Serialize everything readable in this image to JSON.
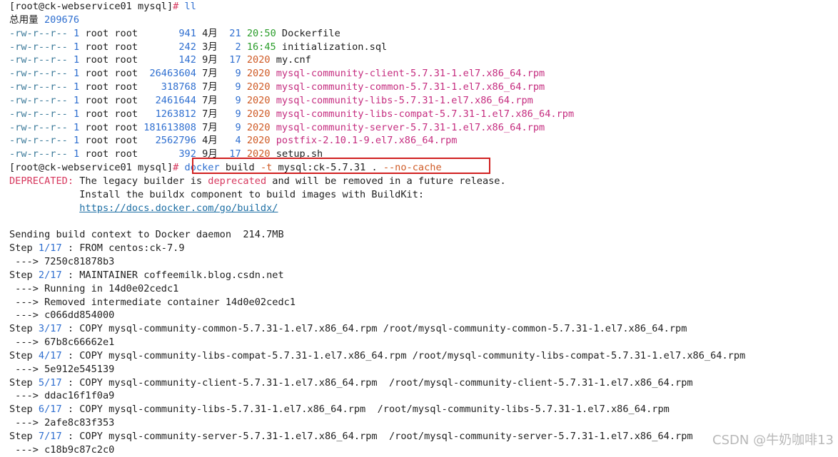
{
  "colors": {
    "background": "#ffffff",
    "perm": "#3c7a9a",
    "size": "#2f6fd0",
    "rpm": "#c52c7f",
    "deprecated": "#d7385e",
    "time": "#2a9d2a",
    "highlight_box": "#d02020"
  },
  "watermark": "CSDN @牛奶咖啡13",
  "lines": [
    {
      "name": "prompt-line-1",
      "segs": [
        [
          "[root@ck-webservice01 mysql]",
          ""
        ],
        [
          "# ",
          "c-red"
        ],
        [
          "ll",
          "c-blue"
        ]
      ]
    },
    {
      "name": "total-line",
      "segs": [
        [
          "总用量 ",
          ""
        ],
        [
          "209676",
          "c-blue"
        ]
      ]
    },
    {
      "name": "ls-row",
      "segs": [
        [
          "-rw-r--r-- ",
          "c-dim"
        ],
        [
          "1",
          "c-blue"
        ],
        [
          " root root       ",
          ""
        ],
        [
          "941",
          "c-blue"
        ],
        [
          " 4月  ",
          ""
        ],
        [
          "21",
          "c-blue"
        ],
        [
          " ",
          ""
        ],
        [
          "20:50",
          "c-green"
        ],
        [
          " Dockerfile",
          ""
        ]
      ]
    },
    {
      "name": "ls-row",
      "segs": [
        [
          "-rw-r--r-- ",
          "c-dim"
        ],
        [
          "1",
          "c-blue"
        ],
        [
          " root root       ",
          ""
        ],
        [
          "242",
          "c-blue"
        ],
        [
          " 3月   ",
          ""
        ],
        [
          "2",
          "c-blue"
        ],
        [
          " ",
          ""
        ],
        [
          "16:45",
          "c-green"
        ],
        [
          " initialization.sql",
          ""
        ]
      ]
    },
    {
      "name": "ls-row",
      "segs": [
        [
          "-rw-r--r-- ",
          "c-dim"
        ],
        [
          "1",
          "c-blue"
        ],
        [
          " root root       ",
          ""
        ],
        [
          "142",
          "c-blue"
        ],
        [
          " 9月  ",
          ""
        ],
        [
          "17",
          "c-blue"
        ],
        [
          " ",
          ""
        ],
        [
          "2020",
          "c-orange"
        ],
        [
          " my.cnf",
          ""
        ]
      ]
    },
    {
      "name": "ls-row",
      "segs": [
        [
          "-rw-r--r-- ",
          "c-dim"
        ],
        [
          "1",
          "c-blue"
        ],
        [
          " root root  ",
          ""
        ],
        [
          "26463604",
          "c-blue"
        ],
        [
          " 7月   ",
          ""
        ],
        [
          "9",
          "c-blue"
        ],
        [
          " ",
          ""
        ],
        [
          "2020",
          "c-orange"
        ],
        [
          " mysql-community-client-5.7.31-1.el7.x86_64.rpm",
          "c-mag"
        ]
      ]
    },
    {
      "name": "ls-row",
      "segs": [
        [
          "-rw-r--r-- ",
          "c-dim"
        ],
        [
          "1",
          "c-blue"
        ],
        [
          " root root    ",
          ""
        ],
        [
          "318768",
          "c-blue"
        ],
        [
          " 7月   ",
          ""
        ],
        [
          "9",
          "c-blue"
        ],
        [
          " ",
          ""
        ],
        [
          "2020",
          "c-orange"
        ],
        [
          " mysql-community-common-5.7.31-1.el7.x86_64.rpm",
          "c-mag"
        ]
      ]
    },
    {
      "name": "ls-row",
      "segs": [
        [
          "-rw-r--r-- ",
          "c-dim"
        ],
        [
          "1",
          "c-blue"
        ],
        [
          " root root   ",
          ""
        ],
        [
          "2461644",
          "c-blue"
        ],
        [
          " 7月   ",
          ""
        ],
        [
          "9",
          "c-blue"
        ],
        [
          " ",
          ""
        ],
        [
          "2020",
          "c-orange"
        ],
        [
          " mysql-community-libs-5.7.31-1.el7.x86_64.rpm",
          "c-mag"
        ]
      ]
    },
    {
      "name": "ls-row",
      "segs": [
        [
          "-rw-r--r-- ",
          "c-dim"
        ],
        [
          "1",
          "c-blue"
        ],
        [
          " root root   ",
          ""
        ],
        [
          "1263812",
          "c-blue"
        ],
        [
          " 7月   ",
          ""
        ],
        [
          "9",
          "c-blue"
        ],
        [
          " ",
          ""
        ],
        [
          "2020",
          "c-orange"
        ],
        [
          " mysql-community-libs-compat-5.7.31-1.el7.x86_64.rpm",
          "c-mag"
        ]
      ]
    },
    {
      "name": "ls-row",
      "segs": [
        [
          "-rw-r--r-- ",
          "c-dim"
        ],
        [
          "1",
          "c-blue"
        ],
        [
          " root root ",
          ""
        ],
        [
          "181613808",
          "c-blue"
        ],
        [
          " 7月   ",
          ""
        ],
        [
          "9",
          "c-blue"
        ],
        [
          " ",
          ""
        ],
        [
          "2020",
          "c-orange"
        ],
        [
          " mysql-community-server-5.7.31-1.el7.x86_64.rpm",
          "c-mag"
        ]
      ]
    },
    {
      "name": "ls-row",
      "segs": [
        [
          "-rw-r--r-- ",
          "c-dim"
        ],
        [
          "1",
          "c-blue"
        ],
        [
          " root root   ",
          ""
        ],
        [
          "2562796",
          "c-blue"
        ],
        [
          " 4月   ",
          ""
        ],
        [
          "4",
          "c-blue"
        ],
        [
          " ",
          ""
        ],
        [
          "2020",
          "c-orange"
        ],
        [
          " postfix-2.10.1-9.el7.x86_64.rpm",
          "c-mag"
        ]
      ]
    },
    {
      "name": "ls-row",
      "segs": [
        [
          "-rw-r--r-- ",
          "c-dim"
        ],
        [
          "1",
          "c-blue"
        ],
        [
          " root root       ",
          ""
        ],
        [
          "392",
          "c-blue"
        ],
        [
          " 9月  ",
          ""
        ],
        [
          "17",
          "c-blue"
        ],
        [
          " ",
          ""
        ],
        [
          "2020",
          "c-orange"
        ],
        [
          " setup.sh",
          ""
        ]
      ]
    },
    {
      "name": "prompt-line-2",
      "segs": [
        [
          "[root@ck-webservice01 mysql]",
          ""
        ],
        [
          "# ",
          "c-red"
        ],
        [
          "docker",
          "c-blue"
        ],
        [
          " build ",
          ""
        ],
        [
          "-t",
          "c-orange"
        ],
        [
          " mysql:ck-5.7.31 . ",
          ""
        ],
        [
          "--no-cache",
          "c-orange"
        ]
      ]
    },
    {
      "name": "deprecated-line",
      "segs": [
        [
          "DEPRECATED:",
          "c-red"
        ],
        [
          " The legacy builder is ",
          ""
        ],
        [
          "deprecated",
          "c-red"
        ],
        [
          " and will be removed in a future release.",
          ""
        ]
      ]
    },
    {
      "name": "output-line",
      "segs": [
        [
          "            Install the buildx component to build images with BuildKit:",
          ""
        ]
      ]
    },
    {
      "name": "output-line",
      "segs": [
        [
          "            ",
          ""
        ],
        [
          "https://docs.docker.com/go/buildx/",
          "c-link"
        ]
      ]
    },
    {
      "name": "blank-line",
      "segs": [
        [
          "",
          ""
        ]
      ]
    },
    {
      "name": "output-line",
      "segs": [
        [
          "Sending build context to Docker daemon  214.7MB",
          ""
        ]
      ]
    },
    {
      "name": "step-line",
      "segs": [
        [
          "Step ",
          ""
        ],
        [
          "1/17",
          "c-blue"
        ],
        [
          " : FROM centos:",
          ""
        ],
        [
          "ck-7.9",
          ""
        ]
      ]
    },
    {
      "name": "output-line",
      "segs": [
        [
          " ---> 7250c81878b3",
          ""
        ]
      ]
    },
    {
      "name": "step-line",
      "segs": [
        [
          "Step ",
          ""
        ],
        [
          "2/17",
          "c-blue"
        ],
        [
          " : MAINTAINER coffeemilk.blog.csdn.net",
          ""
        ]
      ]
    },
    {
      "name": "output-line",
      "segs": [
        [
          " ---> Running in 14d0e02cedc1",
          ""
        ]
      ]
    },
    {
      "name": "output-line",
      "segs": [
        [
          " ---> Removed intermediate container 14d0e02cedc1",
          ""
        ]
      ]
    },
    {
      "name": "output-line",
      "segs": [
        [
          " ---> c066dd854000",
          ""
        ]
      ]
    },
    {
      "name": "step-line",
      "segs": [
        [
          "Step ",
          ""
        ],
        [
          "3/17",
          "c-blue"
        ],
        [
          " : COPY mysql-community-common-5.7.31-1.el7.x86_64.rpm /root/mysql-community-common-5.7.31-1.el7.x86_64.rpm",
          ""
        ]
      ]
    },
    {
      "name": "output-line",
      "segs": [
        [
          " ---> 67b8c66662e1",
          ""
        ]
      ]
    },
    {
      "name": "step-line",
      "segs": [
        [
          "Step ",
          ""
        ],
        [
          "4/17",
          "c-blue"
        ],
        [
          " : COPY mysql-community-libs-compat-5.7.31-1.el7.x86_64.rpm /root/mysql-community-libs-compat-5.7.31-1.el7.x86_64.rpm",
          ""
        ]
      ]
    },
    {
      "name": "output-line",
      "segs": [
        [
          " ---> 5e912e545139",
          ""
        ]
      ]
    },
    {
      "name": "step-line",
      "segs": [
        [
          "Step ",
          ""
        ],
        [
          "5/17",
          "c-blue"
        ],
        [
          " : COPY mysql-community-client-5.7.31-1.el7.x86_64.rpm  /root/mysql-community-client-5.7.31-1.el7.x86_64.rpm",
          ""
        ]
      ]
    },
    {
      "name": "output-line",
      "segs": [
        [
          " ---> ddac16f1f0a9",
          ""
        ]
      ]
    },
    {
      "name": "step-line",
      "segs": [
        [
          "Step ",
          ""
        ],
        [
          "6/17",
          "c-blue"
        ],
        [
          " : COPY mysql-community-libs-5.7.31-1.el7.x86_64.rpm  /root/mysql-community-libs-5.7.31-1.el7.x86_64.rpm",
          ""
        ]
      ]
    },
    {
      "name": "output-line",
      "segs": [
        [
          " ---> 2afe8c83f353",
          ""
        ]
      ]
    },
    {
      "name": "step-line",
      "segs": [
        [
          "Step ",
          ""
        ],
        [
          "7/17",
          "c-blue"
        ],
        [
          " : COPY mysql-community-server-5.7.31-1.el7.x86_64.rpm  /root/mysql-community-server-5.7.31-1.el7.x86_64.rpm",
          ""
        ]
      ]
    },
    {
      "name": "output-line",
      "segs": [
        [
          " ---> c18b9c87c2c0",
          ""
        ]
      ]
    }
  ]
}
